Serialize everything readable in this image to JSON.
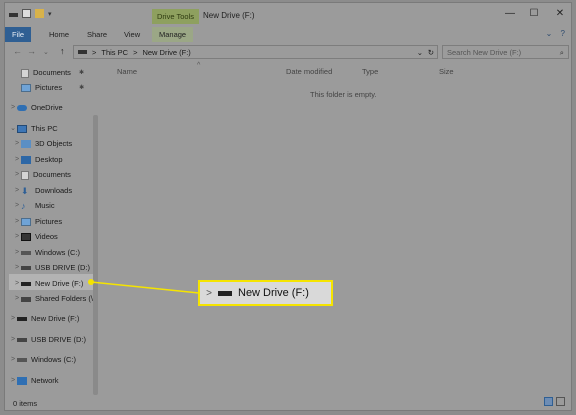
{
  "title": {
    "context_tab": "Drive Tools",
    "window_title": "New Drive (F:)",
    "min": "—",
    "max": "☐",
    "close": "✕"
  },
  "ribbon": {
    "file": "File",
    "home": "Home",
    "share": "Share",
    "view": "View",
    "manage": "Manage",
    "help_glyph": "?",
    "expand_glyph": "⌄"
  },
  "address": {
    "back": "←",
    "forward": "→",
    "dropdown": "⌄",
    "up": "↑",
    "path": [
      "This PC",
      "New Drive (F:)"
    ],
    "separator": ">",
    "refresh": "↻",
    "search_placeholder": "Search New Drive (F:)",
    "search_glyph": "⌕"
  },
  "nav": {
    "quick": [
      {
        "label": "Documents",
        "pin": "📌",
        "icon_color": "#d4d4d4"
      },
      {
        "label": "Pictures",
        "pin": "📌",
        "icon_color": "#6fa3d6"
      }
    ],
    "onedrive": "OneDrive",
    "thispc": "This PC",
    "pc_items": [
      "3D Objects",
      "Desktop",
      "Documents",
      "Downloads",
      "Music",
      "Pictures",
      "Videos",
      "Windows (C:)",
      "USB DRIVE (D:)",
      "New Drive (F:)",
      "Shared Folders (\\\\"
    ],
    "bottom": [
      "New Drive (F:)",
      "USB DRIVE (D:)",
      "Windows (C:)"
    ],
    "network": "Network",
    "chevron_right": ">",
    "chevron_down": "⌄"
  },
  "columns": {
    "name": "Name",
    "date": "Date modified",
    "type": "Type",
    "size": "Size",
    "sort_glyph": "^"
  },
  "empty_message": "This folder is empty.",
  "status": {
    "items": "0 items"
  },
  "callout": {
    "chevron": ">",
    "label": "New Drive (F:)"
  },
  "colors": {
    "highlight": "#f5e400",
    "file_tab": "#2f5f93",
    "context_tab": "#8ea05f"
  }
}
